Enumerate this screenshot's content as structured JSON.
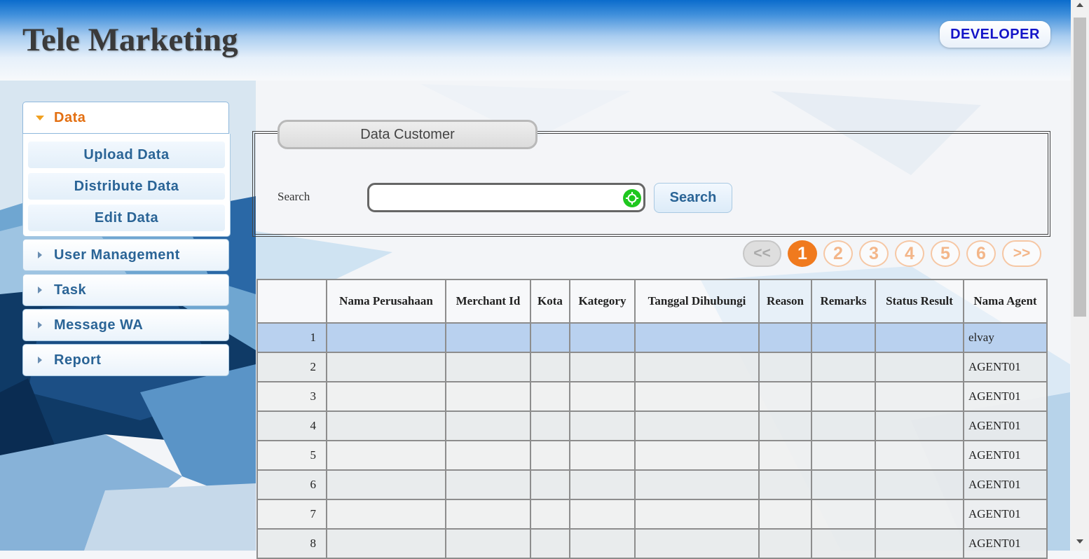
{
  "app": {
    "title": "Tele Marketing",
    "role_badge": "DEVELOPER"
  },
  "sidebar": {
    "active_section": {
      "label": "Data",
      "icon": "caret-down-icon",
      "items": [
        {
          "label": "Upload Data"
        },
        {
          "label": "Distribute Data"
        },
        {
          "label": "Edit Data"
        }
      ]
    },
    "sections": [
      {
        "label": "User Management",
        "icon": "caret-right-icon"
      },
      {
        "label": "Task",
        "icon": "caret-right-icon"
      },
      {
        "label": "Message WA",
        "icon": "caret-right-icon"
      },
      {
        "label": "Report",
        "icon": "caret-right-icon"
      }
    ]
  },
  "search_panel": {
    "legend": "Data Customer",
    "search_label": "Search",
    "search_value": "",
    "search_button": "Search",
    "input_icon": "target-icon"
  },
  "pagination": {
    "prev": "<<",
    "pages": [
      "1",
      "2",
      "3",
      "4",
      "5",
      "6"
    ],
    "current": "1",
    "next": ">>"
  },
  "table": {
    "columns": [
      "",
      "Nama Perusahaan",
      "Merchant Id",
      "Kota",
      "Kategory",
      "Tanggal Dihubungi",
      "Reason",
      "Remarks",
      "Status Result",
      "Nama Agent"
    ],
    "rows": [
      {
        "no": "1",
        "agent": "elvay",
        "selected": true
      },
      {
        "no": "2",
        "agent": "AGENT01"
      },
      {
        "no": "3",
        "agent": "AGENT01"
      },
      {
        "no": "4",
        "agent": "AGENT01"
      },
      {
        "no": "5",
        "agent": "AGENT01"
      },
      {
        "no": "6",
        "agent": "AGENT01"
      },
      {
        "no": "7",
        "agent": "AGENT01"
      },
      {
        "no": "8",
        "agent": "AGENT01"
      }
    ]
  },
  "colors": {
    "accent": "#f07a1e",
    "link": "#2a6496",
    "badge_text": "#1414c8",
    "selected_row": "#b9d1ef"
  }
}
